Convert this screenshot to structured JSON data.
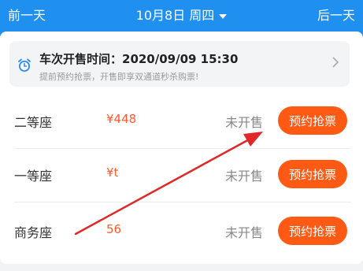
{
  "header": {
    "prev_label": "前一天",
    "date_label": "10月8日 周四",
    "next_label": "后一天"
  },
  "notice": {
    "title": "车次开售时间：2020/09/09  15:30",
    "subtitle": "提前预约抢票，开售即享双通道秒杀购票!"
  },
  "seats": [
    {
      "name": "二等座",
      "price": "¥448",
      "status": "未开售",
      "button": "预约抢票"
    },
    {
      "name": "一等座",
      "price": "¥t",
      "status": "未开售",
      "button": "预约抢票"
    },
    {
      "name": "商务座",
      "price": "56",
      "status": "未开售",
      "button": "预约抢票"
    }
  ],
  "colors": {
    "header_bg": "#1f8ff0",
    "accent": "#ff5a14",
    "arrow": "#e0282a"
  },
  "icons": {
    "clock": "alarm-clock-icon",
    "chevron": "chevron-right-icon",
    "caret": "caret-down-icon"
  }
}
